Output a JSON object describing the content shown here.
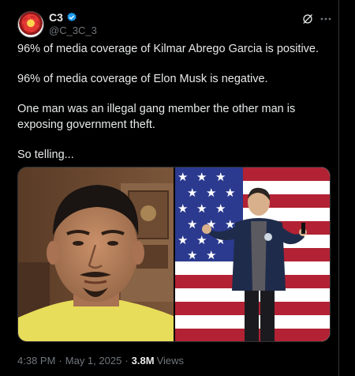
{
  "post": {
    "author": {
      "display_name": "C3",
      "handle": "@C_3C_3",
      "verified": true
    },
    "text": [
      "96% of media coverage of Kilmar Abrego Garcia is positive.",
      "96% of media coverage of Elon Musk is negative.",
      "One man was an illegal gang member the other man is exposing government theft.",
      "So telling..."
    ],
    "media": {
      "left_photo": "man-portrait",
      "right_photo": "man-with-american-flag"
    },
    "time": "4:38 PM",
    "separator": "·",
    "date": "May 1, 2025",
    "views_count": "3.8M",
    "views_label": "Views"
  },
  "icons": {
    "verified": "verified-badge-icon",
    "grok": "grok-icon",
    "more": "more-icon"
  },
  "colors": {
    "background": "#000000",
    "text": "#e7e9ea",
    "secondary_text": "#71767b",
    "verified_blue": "#1d9bf0"
  }
}
